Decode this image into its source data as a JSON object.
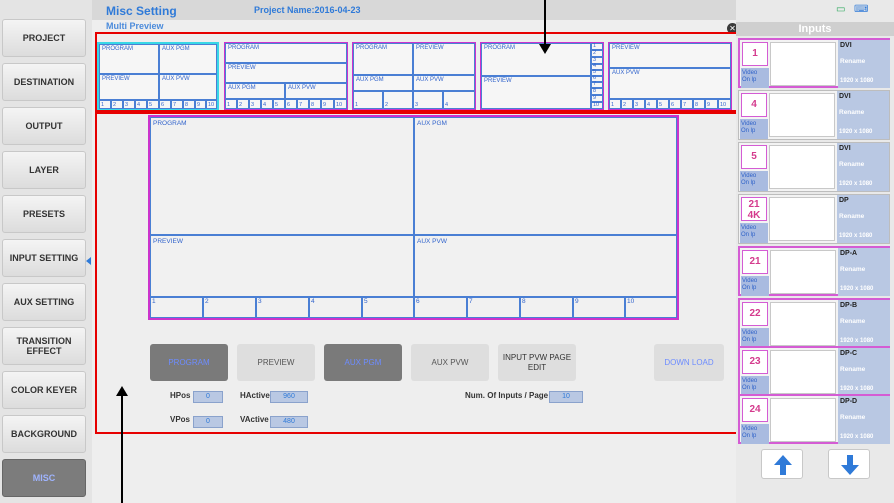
{
  "header": {
    "app_title": "Misc Setting",
    "project_name": "Project Name:2016-04-23",
    "sub_title": "Multi Preview"
  },
  "sidebar": {
    "items": [
      {
        "label": "PROJECT"
      },
      {
        "label": "DESTINATION"
      },
      {
        "label": "OUTPUT"
      },
      {
        "label": "LAYER"
      },
      {
        "label": "PRESETS"
      },
      {
        "label": "INPUT SETTING"
      },
      {
        "label": "AUX SETTING"
      },
      {
        "label": "TRANSITION\nEFFECT"
      },
      {
        "label": "COLOR KEYER"
      },
      {
        "label": "BACKGROUND"
      },
      {
        "label": "MISC"
      }
    ],
    "active": "MISC"
  },
  "presets": [
    {
      "labels": [
        "PROGRAM",
        "AUX PGM",
        "PREVIEW",
        "AUX PVW"
      ],
      "numbers": [
        "1",
        "2",
        "3",
        "4",
        "5",
        "6",
        "7",
        "8",
        "9",
        "10"
      ],
      "selected": true
    },
    {
      "labels": [
        "PROGRAM",
        "PREVIEW",
        "AUX PGM",
        "AUX PVW"
      ],
      "numbers": [
        "1",
        "2",
        "3",
        "4",
        "5",
        "6",
        "7",
        "8",
        "9",
        "10"
      ]
    },
    {
      "labels": [
        "PROGRAM",
        "PREVIEW",
        "AUX PGM",
        "AUX PVW"
      ],
      "numbers": [
        "1",
        "2",
        "3",
        "4"
      ]
    },
    {
      "labels": [
        "PROGRAM",
        "PREVIEW"
      ],
      "numbers": [
        "1",
        "2",
        "3",
        "4",
        "5",
        "6",
        "7",
        "8",
        "9",
        "10"
      ]
    },
    {
      "labels": [
        "PREVIEW",
        "AUX PVW"
      ],
      "numbers": [
        "1",
        "2",
        "3",
        "4",
        "5",
        "6",
        "7",
        "8",
        "9",
        "10"
      ]
    }
  ],
  "editor": {
    "labels": [
      "PROGRAM",
      "AUX PGM",
      "PREVIEW",
      "AUX PVW"
    ],
    "numbers": [
      "1",
      "2",
      "3",
      "4",
      "5",
      "6",
      "7",
      "8",
      "9",
      "10"
    ]
  },
  "buttons": {
    "program": "PROGRAM",
    "preview": "PREVIEW",
    "aux_pgm": "AUX PGM",
    "aux_pvw": "AUX PVW",
    "input_pvw_page_edit": "INPUT PVW PAGE\nEDIT",
    "download": "DOWN LOAD"
  },
  "fields": {
    "hpos_label": "HPos",
    "hpos": "0",
    "vpos_label": "VPos",
    "vpos": "0",
    "hactive_label": "HActive",
    "hactive": "960",
    "vactive_label": "VActive",
    "vactive": "480",
    "inputs_per_page_label": "Num. Of Inputs / Page",
    "inputs_per_page": "10"
  },
  "inputs": {
    "title": "Inputs",
    "cards": [
      {
        "num": "1",
        "status": "Video\nOn lp",
        "type": "DVI",
        "rename": "Rename",
        "res": "1920 x 1080",
        "highlight": true
      },
      {
        "num": "4",
        "status": "Video\nOn lp",
        "type": "DVI",
        "rename": "Rename",
        "res": "1920 x 1080"
      },
      {
        "num": "5",
        "status": "Video\nOn lp",
        "type": "DVI",
        "rename": "Rename",
        "res": "1920 x 1080"
      },
      {
        "num": "21\n4K",
        "status": "Video\nOn lp",
        "type": "DP",
        "rename": "Rename",
        "res": "1920 x 1080"
      },
      {
        "num": "21",
        "status": "Video\nOn lp",
        "type": "DP-A",
        "rename": "Rename",
        "res": "1920 x 1080",
        "highlight": true
      },
      {
        "num": "22",
        "status": "Video\nOn lp",
        "type": "DP-B",
        "rename": "Rename",
        "res": "1920 x 1080",
        "highlight": true
      },
      {
        "num": "23",
        "status": "Video\nOn lp",
        "type": "DP-C",
        "rename": "Rename",
        "res": "1920 x 1080",
        "highlight": true
      },
      {
        "num": "24",
        "status": "Video\nOn lp",
        "type": "DP-D",
        "rename": "Rename",
        "res": "1920 x 1080",
        "highlight": true
      }
    ]
  },
  "icons": {
    "close": "close-icon",
    "scroll_up": "arrow-up-icon",
    "scroll_down": "arrow-down-icon",
    "top_right": [
      "window-icon",
      "keyboard-icon"
    ]
  },
  "colors": {
    "accent": "#2f7ad8",
    "highlight_box": "#e60000",
    "layout_border": "#cc33cc",
    "selected_preset": "#39d7e6"
  }
}
